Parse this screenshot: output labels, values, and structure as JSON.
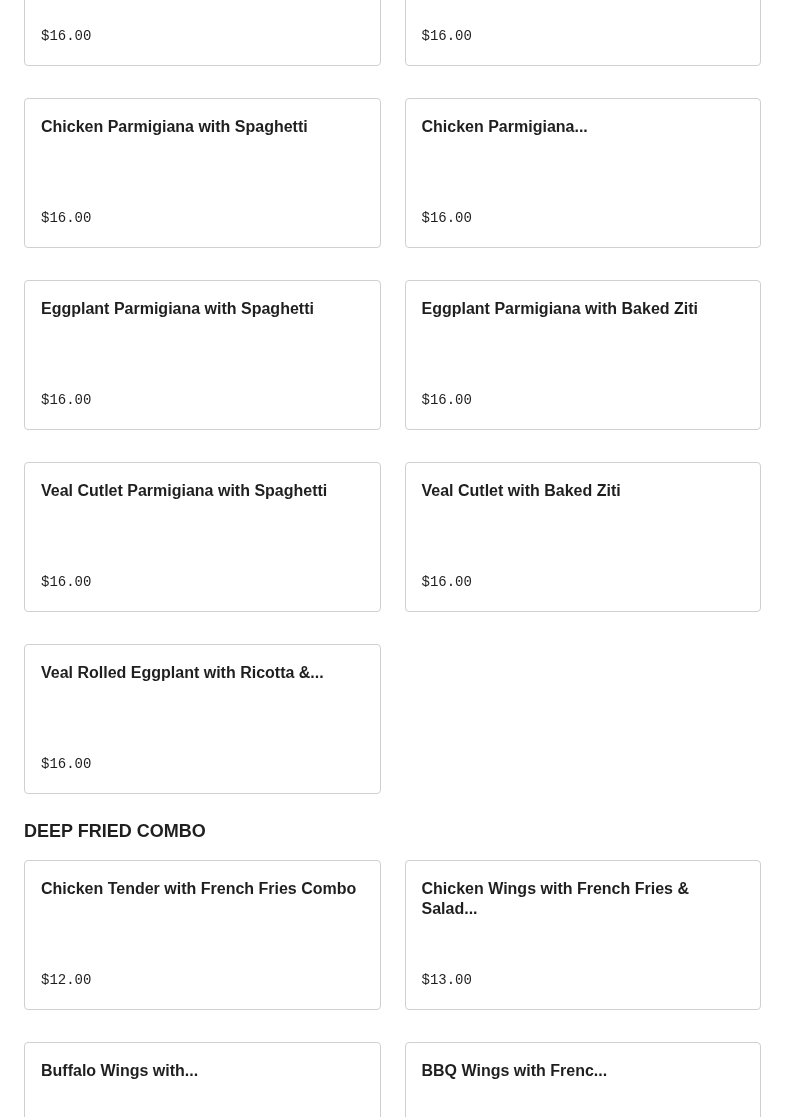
{
  "sections": [
    {
      "items": [
        {
          "price": "$16.00"
        },
        {
          "price": "$16.00"
        },
        {
          "name": "Chicken Parmigiana with Spaghetti",
          "price": "$16.00"
        },
        {
          "name": "Chicken Parmigiana...",
          "price": "$16.00"
        },
        {
          "name": "Eggplant Parmigiana with Spaghetti",
          "price": "$16.00"
        },
        {
          "name": "Eggplant Parmigiana with Baked Ziti",
          "price": "$16.00"
        },
        {
          "name": "Veal Cutlet Parmigiana with Spaghetti",
          "price": "$16.00"
        },
        {
          "name": "Veal Cutlet with Baked Ziti",
          "price": "$16.00"
        },
        {
          "name": "Veal Rolled Eggplant with Ricotta &...",
          "price": "$16.00"
        }
      ]
    },
    {
      "title": "DEEP FRIED COMBO",
      "items": [
        {
          "name": "Chicken Tender with French Fries Combo",
          "price": "$12.00"
        },
        {
          "name": "Chicken Wings with French Fries & Salad...",
          "price": "$13.00"
        },
        {
          "name": "Buffalo Wings with..."
        },
        {
          "name": "BBQ Wings with Frenc..."
        }
      ]
    }
  ]
}
